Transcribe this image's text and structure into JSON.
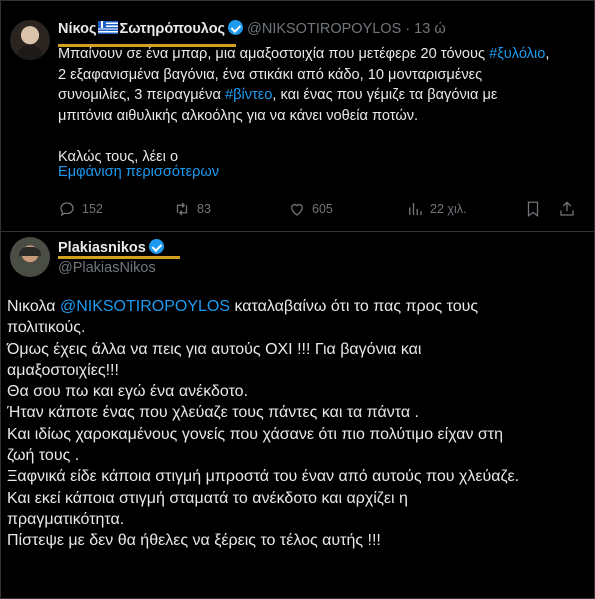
{
  "tweet1": {
    "name": "Νίκος",
    "name_rest": "Σωτηρόπουλος",
    "handle": "@NIKSOTIROPOYLOS",
    "dot": "·",
    "time": "13 ώ",
    "lines": [
      [
        "Μπαίνουν σε ένα μπαρ, μια αμαξοστοιχία που μετέφερε 20 τόνους ",
        "#ξυλόλιο",
        ","
      ],
      [
        "2 εξαφανισμένα βαγόνια, ένα στικάκι από κάδο, 10 μονταρισμένες",
        "",
        ""
      ],
      [
        "συνομιλίες, 3 πειραγμένα ",
        "#βίντεο",
        ", και ένας που γέμιζε τα βαγόνια με"
      ],
      [
        "μπιτόνια αιθυλικής αλκοόλης για να κάνει νοθεία ποτών.",
        "",
        ""
      ]
    ],
    "closing": "Καλώς τους, λέει ο",
    "show_more": "Εμφάνιση περισσότερων",
    "replies": "152",
    "reposts": "83",
    "likes": "605",
    "views": "22 χιλ."
  },
  "tweet2": {
    "name": "Plakiasnikos",
    "handle": "@PlakiasNikos",
    "mention": "@NIKSOTIROPOYLOS",
    "lines": [
      [
        "Νικολα ",
        "@NIKSOTIROPOYLOS",
        " καταλαβαίνω ότι το πας προς τους"
      ],
      [
        "πολιτικούς.",
        "",
        ""
      ],
      [
        "Όμως έχεις άλλα να πεις για αυτούς ΟΧΙ !!! Για βαγόνια και",
        "",
        ""
      ],
      [
        "αμαξοστοιχίες!!!",
        "",
        ""
      ],
      [
        "Θα σου πω και εγώ ένα ανέκδοτο.",
        "",
        ""
      ],
      [
        "Ήταν κάποτε ένας που χλεύαζε τους πάντες και τα πάντα .",
        "",
        ""
      ],
      [
        "Και ιδίως χαροκαμένους γονείς που χάσανε ότι πιο πολύτιμο είχαν στη",
        "",
        ""
      ],
      [
        "ζωή τους .",
        "",
        ""
      ],
      [
        "Ξαφνικά είδε κάποια στιγμή μπροστά του έναν από αυτούς που χλεύαζε.",
        "",
        ""
      ],
      [
        "Και εκεί κάποια στιγμή σταματά το ανέκδοτο και αρχίζει η",
        "",
        ""
      ],
      [
        "πραγματικότητα.",
        "",
        ""
      ],
      [
        "Πίστεψε με δεν θα ήθελες να ξέρεις το τέλος αυτής !!!",
        "",
        ""
      ]
    ]
  },
  "colors": {
    "link": "#1d9bf0",
    "highlight": "#d4a020",
    "muted": "#71767b",
    "text": "#e7e9ea"
  }
}
